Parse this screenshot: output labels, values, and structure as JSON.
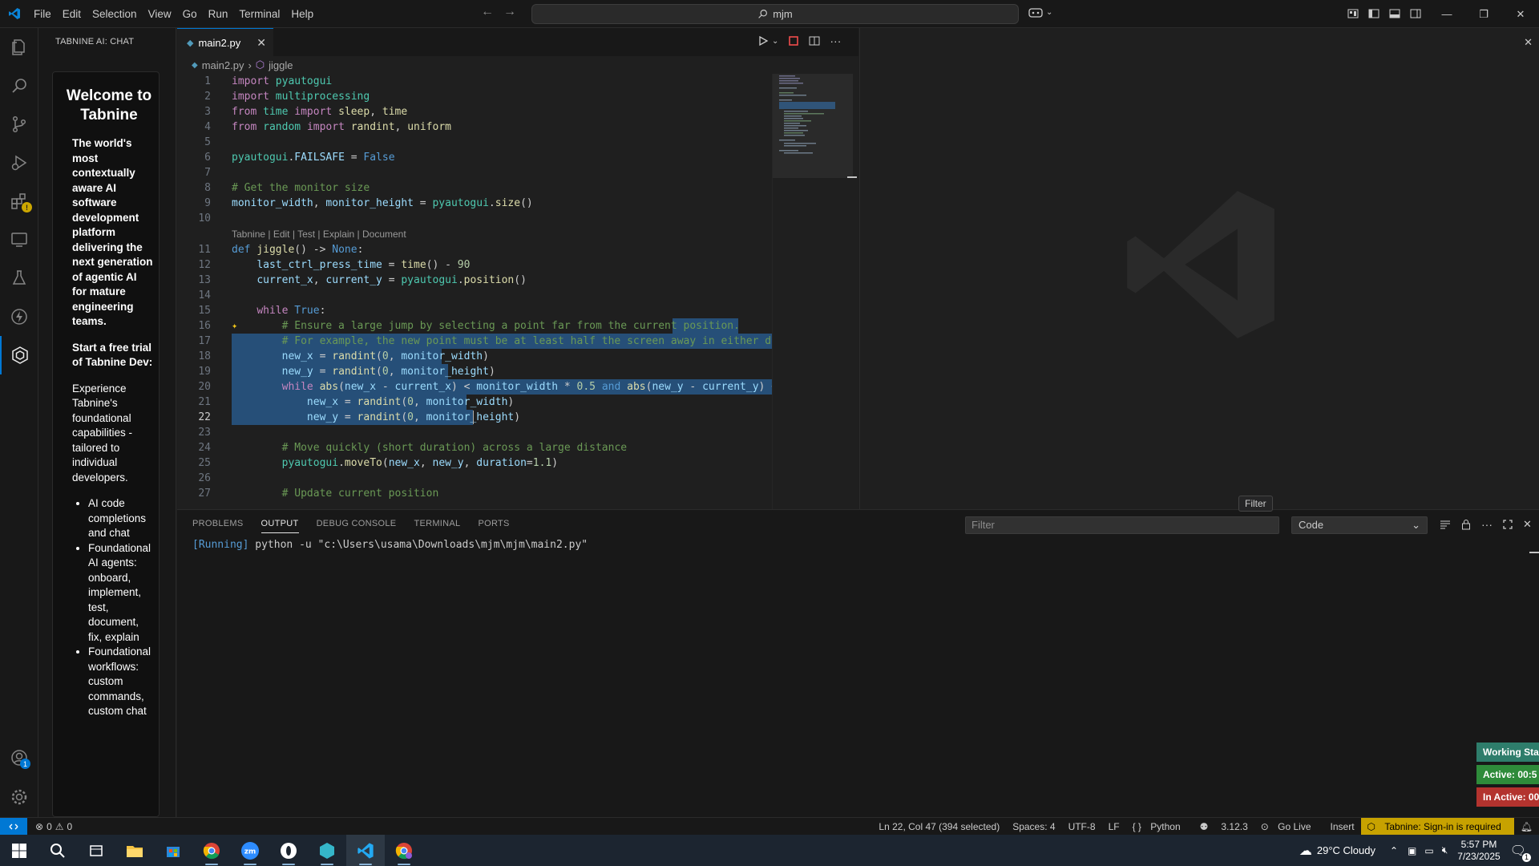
{
  "titlebar": {
    "menu": [
      "File",
      "Edit",
      "Selection",
      "View",
      "Go",
      "Run",
      "Terminal",
      "Help"
    ],
    "search_text": "mjm"
  },
  "sidebar": {
    "title": "TABNINE AI: CHAT",
    "welcome_heading": "Welcome to Tabnine",
    "intro": "The world's most contextually aware AI software development platform delivering the next generation of agentic AI for mature engineering teams.",
    "trial": "Start a free trial of Tabnine Dev:",
    "experience": "Experience Tabnine's foundational capabilities - tailored to individual developers.",
    "bullets": [
      "AI code completions and chat",
      "Foundational AI agents: onboard, implement, test, document, fix, explain",
      "Foundational workflows: custom commands, custom chat"
    ]
  },
  "editor": {
    "tab_label": "main2.py",
    "breadcrumb_file": "main2.py",
    "breadcrumb_symbol": "jiggle",
    "codelens": "Tabnine | Edit | Test | Explain | Document",
    "line_numbers": [
      "1",
      "2",
      "3",
      "4",
      "5",
      "6",
      "7",
      "8",
      "9",
      "10",
      "11",
      "12",
      "13",
      "14",
      "15",
      "16",
      "17",
      "18",
      "19",
      "20",
      "21",
      "22",
      "23",
      "24",
      "25",
      "26",
      "27"
    ],
    "current_line": "22"
  },
  "panel": {
    "tabs": [
      "PROBLEMS",
      "OUTPUT",
      "DEBUG CONSOLE",
      "TERMINAL",
      "PORTS"
    ],
    "active_tab": "OUTPUT",
    "filter_placeholder": "Filter",
    "channel": "Code",
    "output_running": "[Running]",
    "output_cmd": " python -u \"c:\\Users\\usama\\Downloads\\mjm\\mjm\\main2.py\"",
    "tooltip": "Filter",
    "status_stack": [
      {
        "label": "Working Sta",
        "color": "#2e7d6b"
      },
      {
        "label": "Active: 00:5",
        "color": "#2e8b3a"
      },
      {
        "label": "In Active: 00",
        "color": "#b3332e"
      }
    ]
  },
  "statusbar": {
    "errors": "0",
    "warnings": "0",
    "position": "Ln 22, Col 47 (394 selected)",
    "spaces": "Spaces: 4",
    "encoding": "UTF-8",
    "eol": "LF",
    "language": "Python",
    "python_version": "3.12.3",
    "golive": "Go Live",
    "mode": "Insert",
    "tabnine": "Tabnine: Sign-in is required"
  },
  "taskbar": {
    "weather": "29°C  Cloudy",
    "time": "5:57 PM",
    "date": "7/23/2025",
    "notifications": "1"
  },
  "colors": {
    "accent": "#0078d4",
    "selection": "#264f78",
    "tabnine_yellow": "#c7a200"
  }
}
